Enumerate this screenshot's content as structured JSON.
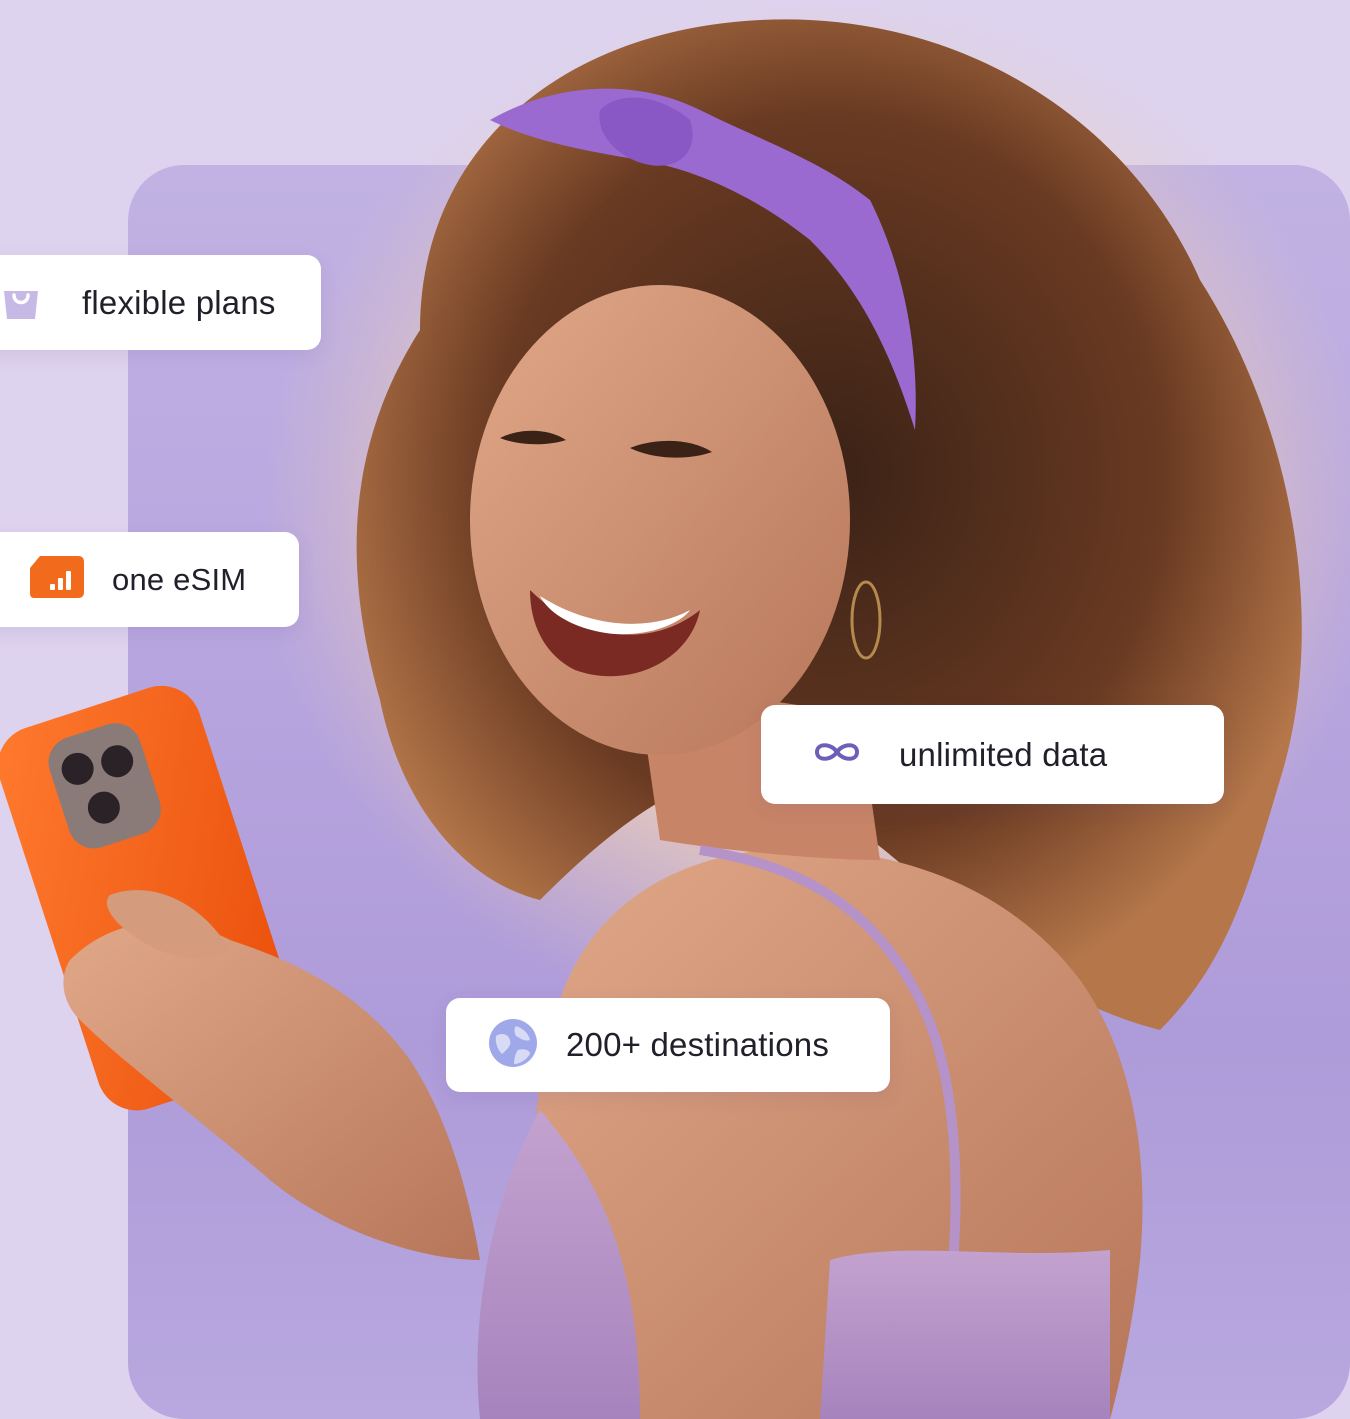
{
  "hero": {
    "features": {
      "plans": {
        "label": "flexible plans",
        "icon": "shopping-bag-icon",
        "icon_color": "#c6b9e6"
      },
      "esim": {
        "label": "one eSIM",
        "icon": "esim-signal-icon",
        "icon_color": "#f26a1b"
      },
      "data": {
        "label": "unlimited data",
        "icon": "infinity-icon",
        "icon_color": "#6b5fb8"
      },
      "destinations": {
        "label": "200+ destinations",
        "icon": "globe-icon",
        "icon_color": "#9fa8e8"
      }
    }
  },
  "colors": {
    "page_background": "#ddd3ee",
    "panel": "#b7a5df",
    "phone_case": "#f25a12",
    "headband": "#9b6ad0",
    "badge_background": "#ffffff"
  }
}
